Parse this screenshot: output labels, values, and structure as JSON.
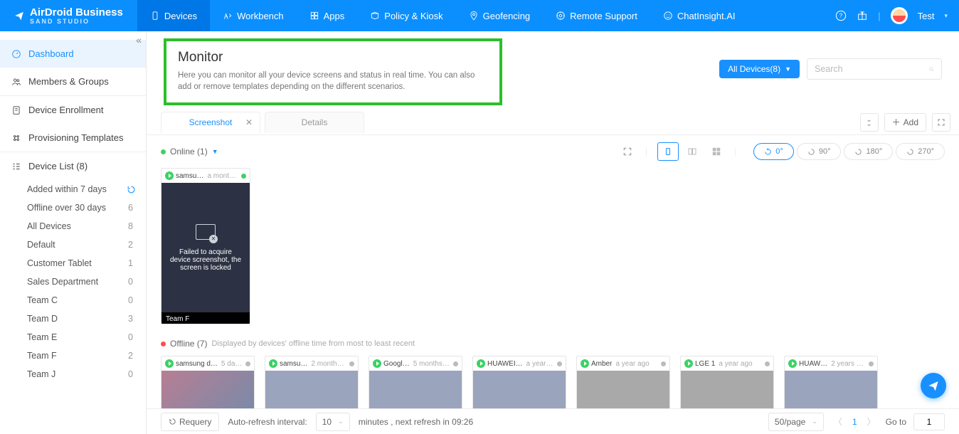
{
  "brand": {
    "name": "AirDroid Business",
    "sub": "SAND STUDIO"
  },
  "topnav": {
    "items": [
      {
        "label": "Devices",
        "icon": "device",
        "active": true
      },
      {
        "label": "Workbench",
        "icon": "workbench",
        "active": false
      },
      {
        "label": "Apps",
        "icon": "apps",
        "active": false
      },
      {
        "label": "Policy & Kiosk",
        "icon": "policy",
        "active": false
      },
      {
        "label": "Geofencing",
        "icon": "geo",
        "active": false
      },
      {
        "label": "Remote Support",
        "icon": "support",
        "active": false
      },
      {
        "label": "ChatInsight.AI",
        "icon": "ai",
        "active": false
      }
    ],
    "user": "Test"
  },
  "sidebar": {
    "main": [
      {
        "label": "Dashboard",
        "icon": "dashboard",
        "active": true
      },
      {
        "label": "Members & Groups",
        "icon": "members",
        "active": false
      }
    ],
    "second": [
      {
        "label": "Device Enrollment",
        "icon": "enroll"
      },
      {
        "label": "Provisioning Templates",
        "icon": "template"
      }
    ],
    "device_list": {
      "label": "Device List",
      "count": 8
    },
    "subs": [
      {
        "label": "Added within 7 days",
        "count": "",
        "refresh": true
      },
      {
        "label": "Offline over 30 days",
        "count": "6"
      },
      {
        "label": "All Devices",
        "count": "8"
      },
      {
        "label": "Default",
        "count": "2"
      },
      {
        "label": "Customer Tablet",
        "count": "1"
      },
      {
        "label": "Sales Department",
        "count": "0"
      },
      {
        "label": "Team C",
        "count": "0"
      },
      {
        "label": "Team D",
        "count": "3"
      },
      {
        "label": "Team E",
        "count": "0"
      },
      {
        "label": "Team F",
        "count": "2"
      },
      {
        "label": "Team J",
        "count": "0"
      }
    ]
  },
  "header": {
    "title": "Monitor",
    "desc": "Here you can monitor all your device screens and status in real time. You can also add or remove templates depending on the different scenarios.",
    "filter": "All Devices(8)",
    "search_ph": "Search"
  },
  "tabs": {
    "t1": "Screenshot",
    "t2": "Details",
    "add": "Add"
  },
  "rotations": {
    "r0": "0°",
    "r90": "90°",
    "r180": "180°",
    "r270": "270°"
  },
  "online": {
    "label": "Online (1)",
    "cards": [
      {
        "name": "samsu…",
        "time": "a month …",
        "msg": "Failed to acquire device screenshot, the screen is locked",
        "footer": "Team F"
      }
    ]
  },
  "offline": {
    "label": "Offline (7)",
    "note": "Displayed by devices' offline time from most to least recent",
    "cards": [
      {
        "name": "samsung d…",
        "time": "5 da…",
        "cls": "g1"
      },
      {
        "name": "samsu…",
        "time": "2 months…",
        "cls": ""
      },
      {
        "name": "Googl…",
        "time": "5 months …",
        "cls": ""
      },
      {
        "name": "HUAWEI…",
        "time": "a year …",
        "cls": ""
      },
      {
        "name": "Amber",
        "time": "a year ago",
        "cls": "g3"
      },
      {
        "name": "LGE 1",
        "time": "a year ago",
        "cls": "g3"
      },
      {
        "name": "HUAW…",
        "time": "2 years …",
        "cls": ""
      }
    ]
  },
  "footer": {
    "requery": "Requery",
    "auto_label": "Auto-refresh interval:",
    "interval": "10",
    "minutes_text": "minutes , next refresh in 09:26",
    "perpage": "50/page",
    "page": "1",
    "goto": "Go to",
    "goto_val": "1"
  }
}
